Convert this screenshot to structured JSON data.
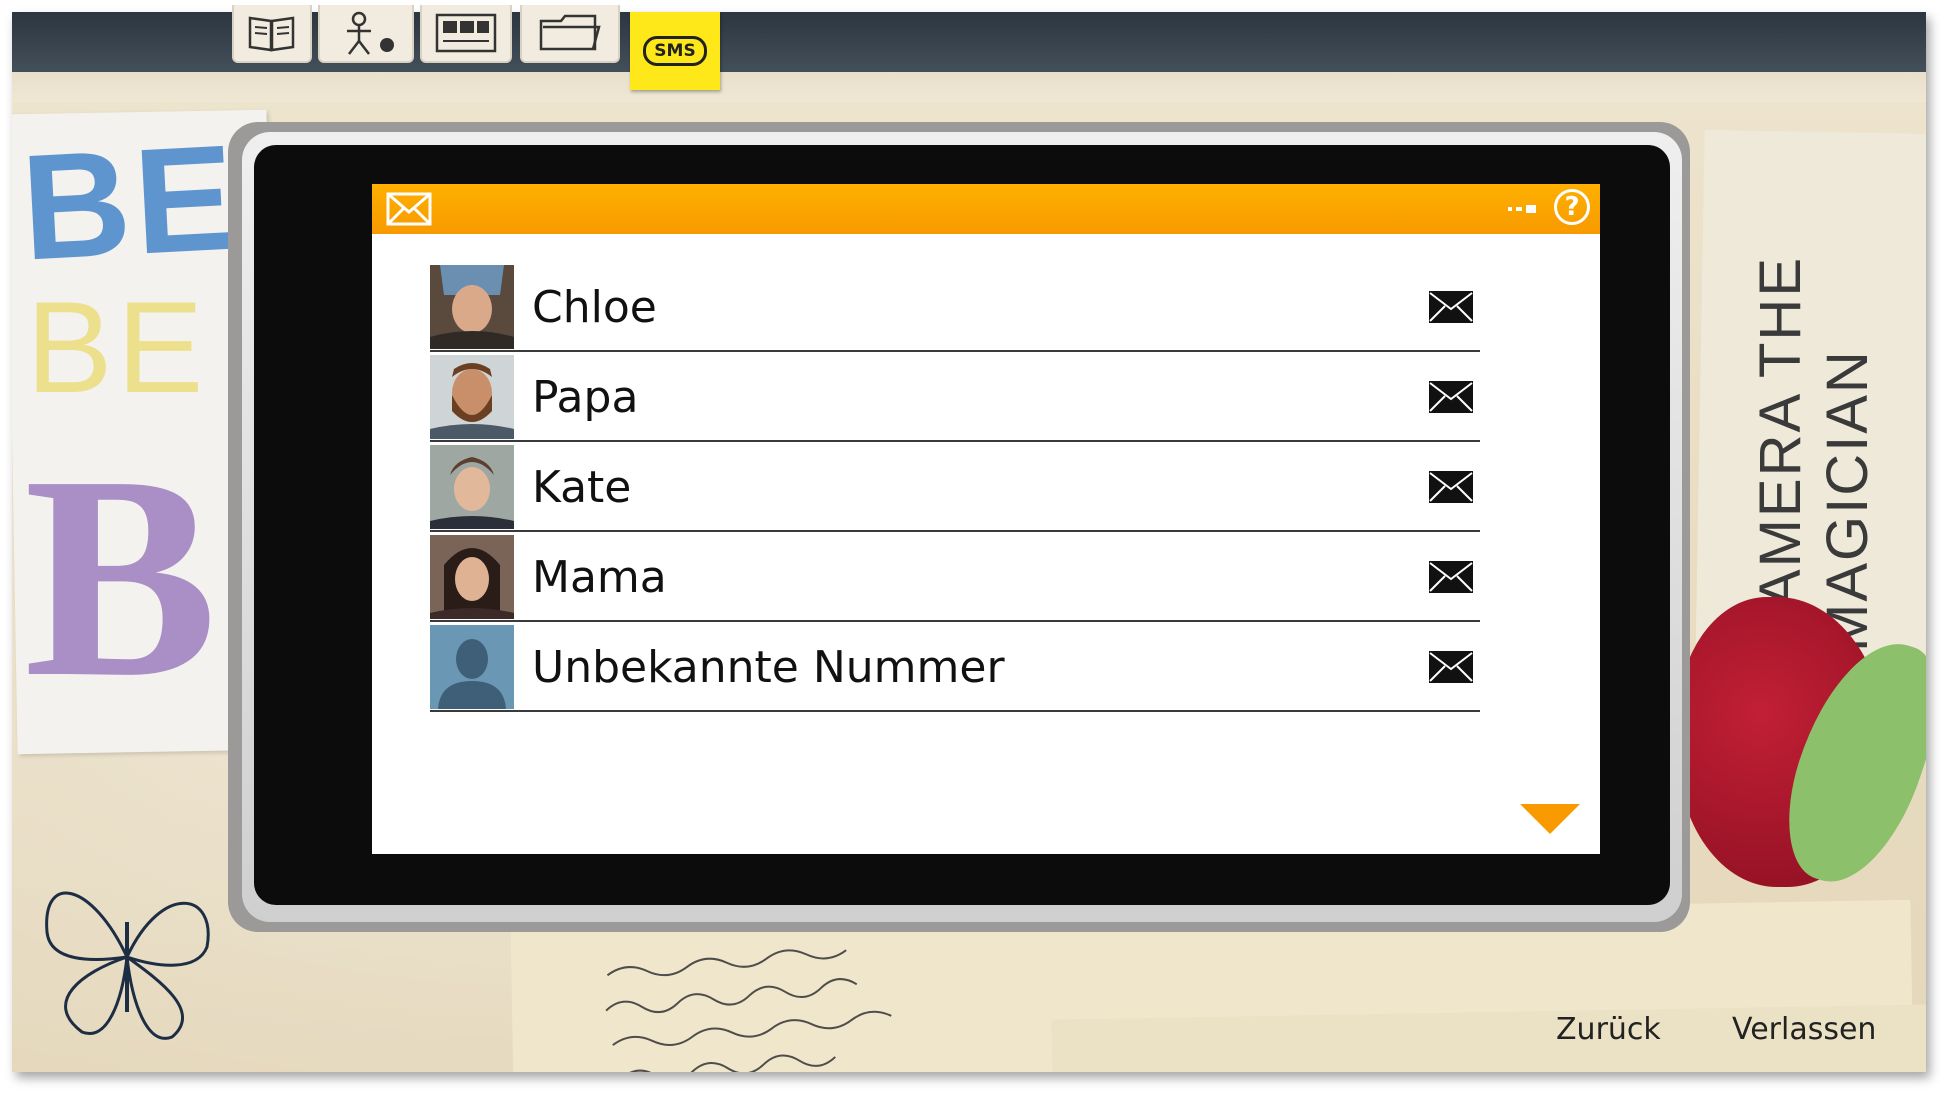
{
  "menu_tabs": [
    {
      "name": "journal",
      "icon": "book-icon"
    },
    {
      "name": "characters",
      "icon": "stick-figure-icon"
    },
    {
      "name": "photos",
      "icon": "photo-album-icon"
    },
    {
      "name": "files",
      "icon": "folder-icon"
    },
    {
      "name": "sms",
      "label": "SMS",
      "icon": "sms-bubble-icon",
      "active": true
    }
  ],
  "phone": {
    "header_icon": "envelope-icon",
    "help_label": "?"
  },
  "contacts": [
    {
      "name": "Chloe",
      "avatar": "chloe",
      "icon": "envelope-icon"
    },
    {
      "name": "Papa",
      "avatar": "papa",
      "icon": "envelope-icon"
    },
    {
      "name": "Kate",
      "avatar": "kate",
      "icon": "envelope-icon"
    },
    {
      "name": "Mama",
      "avatar": "mama",
      "icon": "envelope-icon"
    },
    {
      "name": "Unbekannte Nummer",
      "avatar": "unknown",
      "icon": "envelope-icon"
    }
  ],
  "footer": {
    "back_label": "Zurück",
    "exit_label": "Verlassen"
  },
  "background": {
    "sticker_left_lines": [
      "BE",
      "BE",
      "BI"
    ],
    "sticker_right_text": "CAMERA THE MAGICIAN"
  },
  "colors": {
    "header_orange": "#ffb000",
    "sms_tab_yellow": "#ffe81a",
    "scroll_arrow": "#f99a00"
  }
}
